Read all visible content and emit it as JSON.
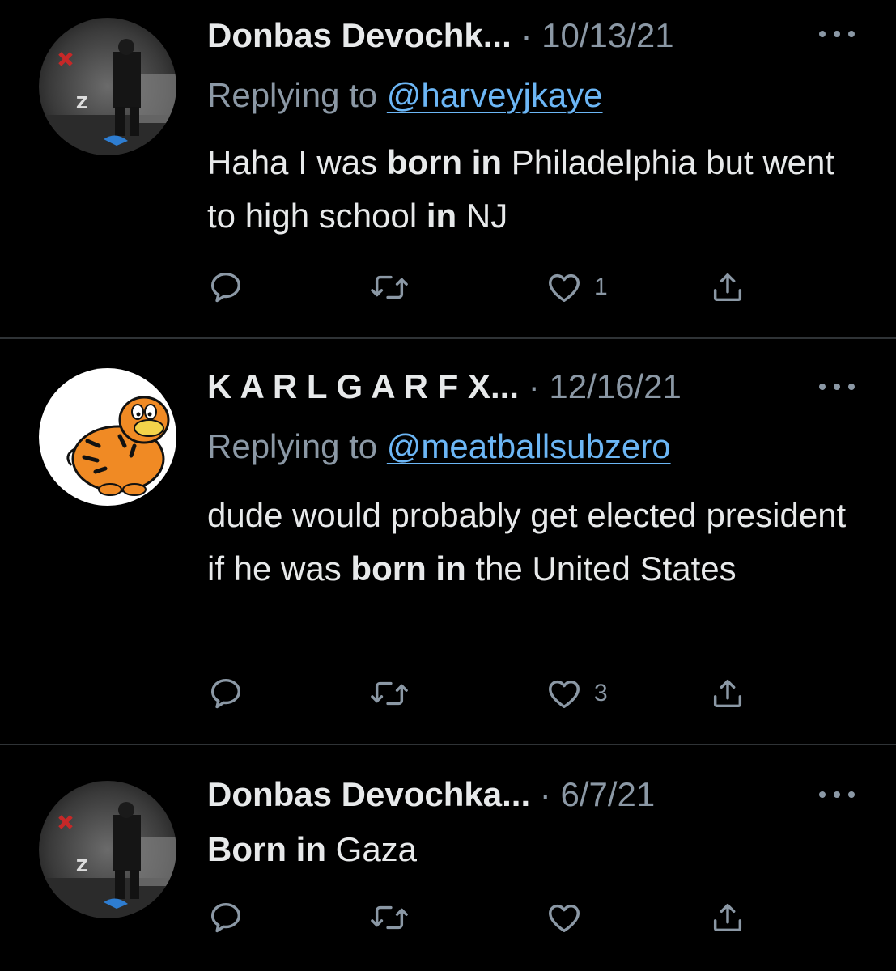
{
  "tweets": [
    {
      "name": "Donbas Devochk...",
      "separator": "·",
      "date": "10/13/21",
      "reply_prefix": "Replying to",
      "reply_handle": "@harveyjkaye",
      "text_segments": [
        {
          "t": "Haha I was ",
          "bold": false
        },
        {
          "t": "born in",
          "bold": true
        },
        {
          "t": " Philadelphia but went to high school ",
          "bold": false
        },
        {
          "t": "in",
          "bold": true
        },
        {
          "t": " NJ",
          "bold": false
        }
      ],
      "like_count": "1"
    },
    {
      "name": "K A R L G A R F X...",
      "separator": "·",
      "date": "12/16/21",
      "reply_prefix": "Replying to",
      "reply_handle": "@meatballsubzero",
      "text_segments": [
        {
          "t": "dude would probably get elected president if he was ",
          "bold": false
        },
        {
          "t": "born in",
          "bold": true
        },
        {
          "t": " the United States",
          "bold": false
        }
      ],
      "like_count": "3"
    },
    {
      "name": "Donbas Devochka...",
      "separator": "·",
      "date": "6/7/21",
      "text_segments": [
        {
          "t": "Born in",
          "bold": true
        },
        {
          "t": " Gaza",
          "bold": false
        }
      ],
      "like_count": ""
    }
  ],
  "icons": {
    "reply": "reply-icon",
    "retweet": "retweet-icon",
    "like": "heart-icon",
    "share": "share-icon",
    "more": "more-icon"
  },
  "colors": {
    "background": "#000000",
    "text": "#e7e9ea",
    "muted": "#8b98a5",
    "link": "#6cb6f5",
    "divider": "#2f3336"
  }
}
